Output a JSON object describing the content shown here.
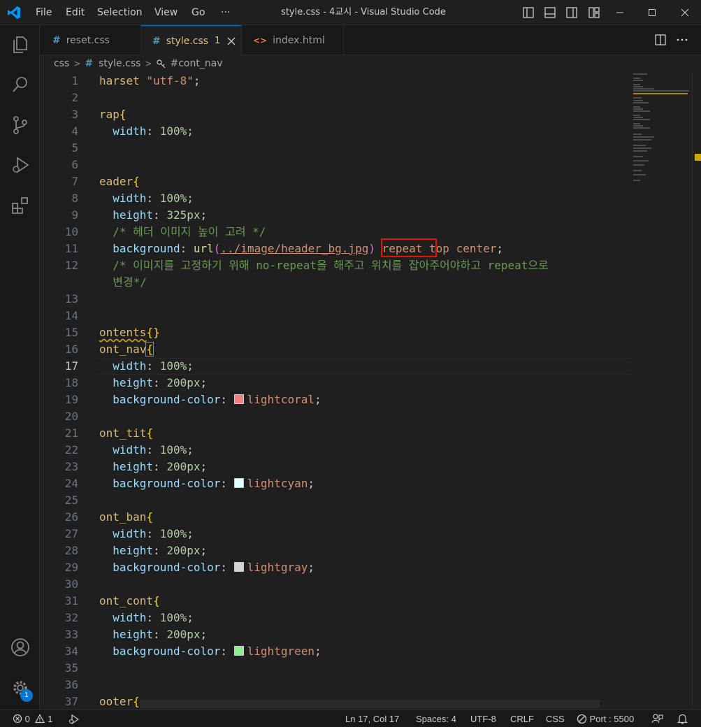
{
  "menu": [
    "File",
    "Edit",
    "Selection",
    "View",
    "Go",
    "···"
  ],
  "window_title": "style.css - 4교시 - Visual Studio Code",
  "tabs": [
    {
      "icon": "#",
      "label": "reset.css",
      "badge": "",
      "active": false
    },
    {
      "icon": "#",
      "label": "style.css",
      "badge": "1",
      "active": true
    },
    {
      "icon": "<>",
      "label": "index.html",
      "badge": "",
      "active": false
    }
  ],
  "breadcrumb": {
    "folder": "css",
    "file_icon": "#",
    "file": "style.css",
    "symbol": "#cont_nav"
  },
  "activity_badge": "1",
  "colors": {
    "accent": "#0078d4",
    "highlight_box": "#e51400",
    "warning": "#cca700"
  },
  "code": {
    "n1": "1",
    "l1a": "harset ",
    "l1b": "\"utf-8\"",
    "l1c": ";",
    "n2": "2",
    "n3": "3",
    "l3a": "rap",
    "l3b": "{",
    "n4": "4",
    "l4a": "width",
    "l4b": ": ",
    "l4c": "100%",
    "l4d": ";",
    "n5": "5",
    "n6": "6",
    "n7": "7",
    "l7a": "eader",
    "l7b": "{",
    "n8": "8",
    "l8a": "width",
    "l8b": ": ",
    "l8c": "100%",
    "l8d": ";",
    "n9": "9",
    "l9a": "height",
    "l9b": ": ",
    "l9c": "325px",
    "l9d": ";",
    "n10": "10",
    "l10": "/* 헤더 이미지 높이 고려 */",
    "n11": "11",
    "l11a": "background",
    "l11b": ": ",
    "l11c": "url",
    "l11d": "(",
    "l11e": "../image/header_bg.jpg",
    "l11f": ")",
    "l11g": " repeat top center",
    "l11h": ";",
    "n12": "12",
    "l12": "/* 이미지를 고정하기 위해 no-repeat을 해주고 위치를 잡아주어야하고 repeat으로",
    "l12b": "변경*/",
    "n13": "13",
    "n14": "14",
    "n15": "15",
    "l15a": "ontents",
    "l15b": "{}",
    "n16": "16",
    "l16a": "ont_nav",
    "l16b": "{",
    "n17": "17",
    "l17a": "width",
    "l17b": ": ",
    "l17c": "100%",
    "l17d": ";",
    "n18": "18",
    "l18a": "height",
    "l18b": ": ",
    "l18c": "200px",
    "l18d": ";",
    "n19": "19",
    "l19a": "background-color",
    "l19b": ": ",
    "l19c": "lightcoral",
    "l19d": ";",
    "n20": "20",
    "n21": "21",
    "l21a": "ont_tit",
    "l21b": "{",
    "n22": "22",
    "l22a": "width",
    "l22b": ": ",
    "l22c": "100%",
    "l22d": ";",
    "n23": "23",
    "l23a": "height",
    "l23b": ": ",
    "l23c": "200px",
    "l23d": ";",
    "n24": "24",
    "l24a": "background-color",
    "l24b": ": ",
    "l24c": "lightcyan",
    "l24d": ";",
    "n25": "25",
    "n26": "26",
    "l26a": "ont_ban",
    "l26b": "{",
    "n27": "27",
    "l27a": "width",
    "l27b": ": ",
    "l27c": "100%",
    "l27d": ";",
    "n28": "28",
    "l28a": "height",
    "l28b": ": ",
    "l28c": "200px",
    "l28d": ";",
    "n29": "29",
    "l29a": "background-color",
    "l29b": ": ",
    "l29c": "lightgray",
    "l29d": ";",
    "n30": "30",
    "n31": "31",
    "l31a": "ont_cont",
    "l31b": "{",
    "n32": "32",
    "l32a": "width",
    "l32b": ": ",
    "l32c": "100%",
    "l32d": ";",
    "n33": "33",
    "l33a": "height",
    "l33b": ": ",
    "l33c": "200px",
    "l33d": ";",
    "n34": "34",
    "l34a": "background-color",
    "l34b": ": ",
    "l34c": "lightgreen",
    "l34d": ";",
    "n35": "35",
    "n36": "36",
    "n37": "37",
    "l37a": "ooter",
    "l37b": "{"
  },
  "swatch_colors": {
    "lightcoral": "#f08080",
    "lightcyan": "#e0ffff",
    "lightgray": "#d3d3d3",
    "lightgreen": "#90ee90"
  },
  "status": {
    "errors": "0",
    "warnings": "1",
    "position": "Ln 17, Col 17",
    "spaces": "Spaces: 4",
    "encoding": "UTF-8",
    "eol": "CRLF",
    "language": "CSS",
    "port": "Port : 5500"
  }
}
